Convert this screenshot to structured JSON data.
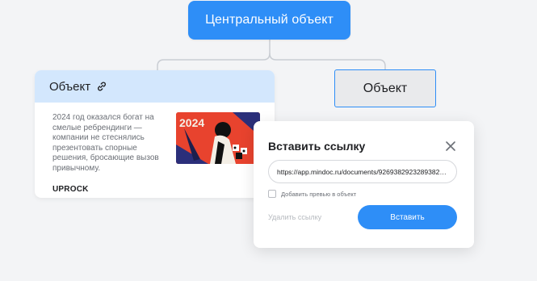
{
  "central_node": {
    "label": "Центральный объект"
  },
  "card": {
    "title": "Объект",
    "description": "2024 год оказался богат на смелые ребрендинги — компании не стеснялись презентовать спорные решения, бросающие вызов привычному.",
    "source": "UPROCK",
    "thumbnail_text": "2024"
  },
  "second_node": {
    "label": "Объект"
  },
  "dialog": {
    "title": "Вставить ссылку",
    "url_value": "https://app.mindoc.ru/documents/92693829232893828383...",
    "preview_label": "Добавить превью в объект",
    "remove_label": "Удалить ссылку",
    "insert_label": "Вставить"
  },
  "colors": {
    "accent": "#2e8ef7",
    "card_header": "#d3e7fd",
    "background": "#f3f4f6"
  },
  "icons": [
    "link-icon",
    "close-icon",
    "checkbox-icon"
  ]
}
